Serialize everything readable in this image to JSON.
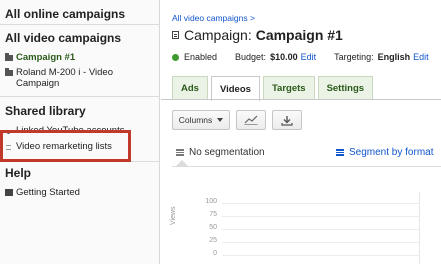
{
  "sidebar": {
    "all_online": "All online campaigns",
    "all_video": "All video campaigns",
    "campaigns": [
      {
        "label": "Campaign #1",
        "active": true
      },
      {
        "label": "Roland M-200 i - Video Campaign",
        "line1": "Roland M-200 i - Video",
        "line2": "Campaign",
        "active": false
      }
    ],
    "shared_library": "Shared library",
    "shared_items": [
      {
        "label": "Linked YouTube accounts"
      },
      {
        "label": "Video remarketing lists"
      }
    ],
    "help": "Help",
    "help_items": [
      {
        "label": "Getting Started",
        "icon": "book-icon"
      }
    ]
  },
  "main": {
    "breadcrumb": "All video campaigns >",
    "title_prefix": "Campaign:",
    "title_name": "Campaign #1",
    "status": "Enabled",
    "budget_label": "Budget:",
    "budget_value": "$10.00",
    "budget_edit": "Edit",
    "targeting_label": "Targeting:",
    "targeting_value": "English",
    "targeting_edit": "Edit",
    "tabs": [
      {
        "label": "Ads",
        "active": false
      },
      {
        "label": "Videos",
        "active": true
      },
      {
        "label": "Targets",
        "active": false
      },
      {
        "label": "Settings",
        "active": false
      }
    ],
    "toolbar": {
      "columns": "Columns",
      "chart_icon": "line-chart-icon",
      "download_icon": "download-icon"
    },
    "segmentation": "No segmentation",
    "segment_link": "Segment by format",
    "chart": {
      "y_label": "Views",
      "ticks": [
        "100",
        "75",
        "50",
        "25",
        "0"
      ]
    }
  },
  "colors": {
    "link": "#1155cc",
    "status_green": "#3d9a2f",
    "highlight": "#c0392b",
    "tab_bg": "#eaf3e5"
  }
}
